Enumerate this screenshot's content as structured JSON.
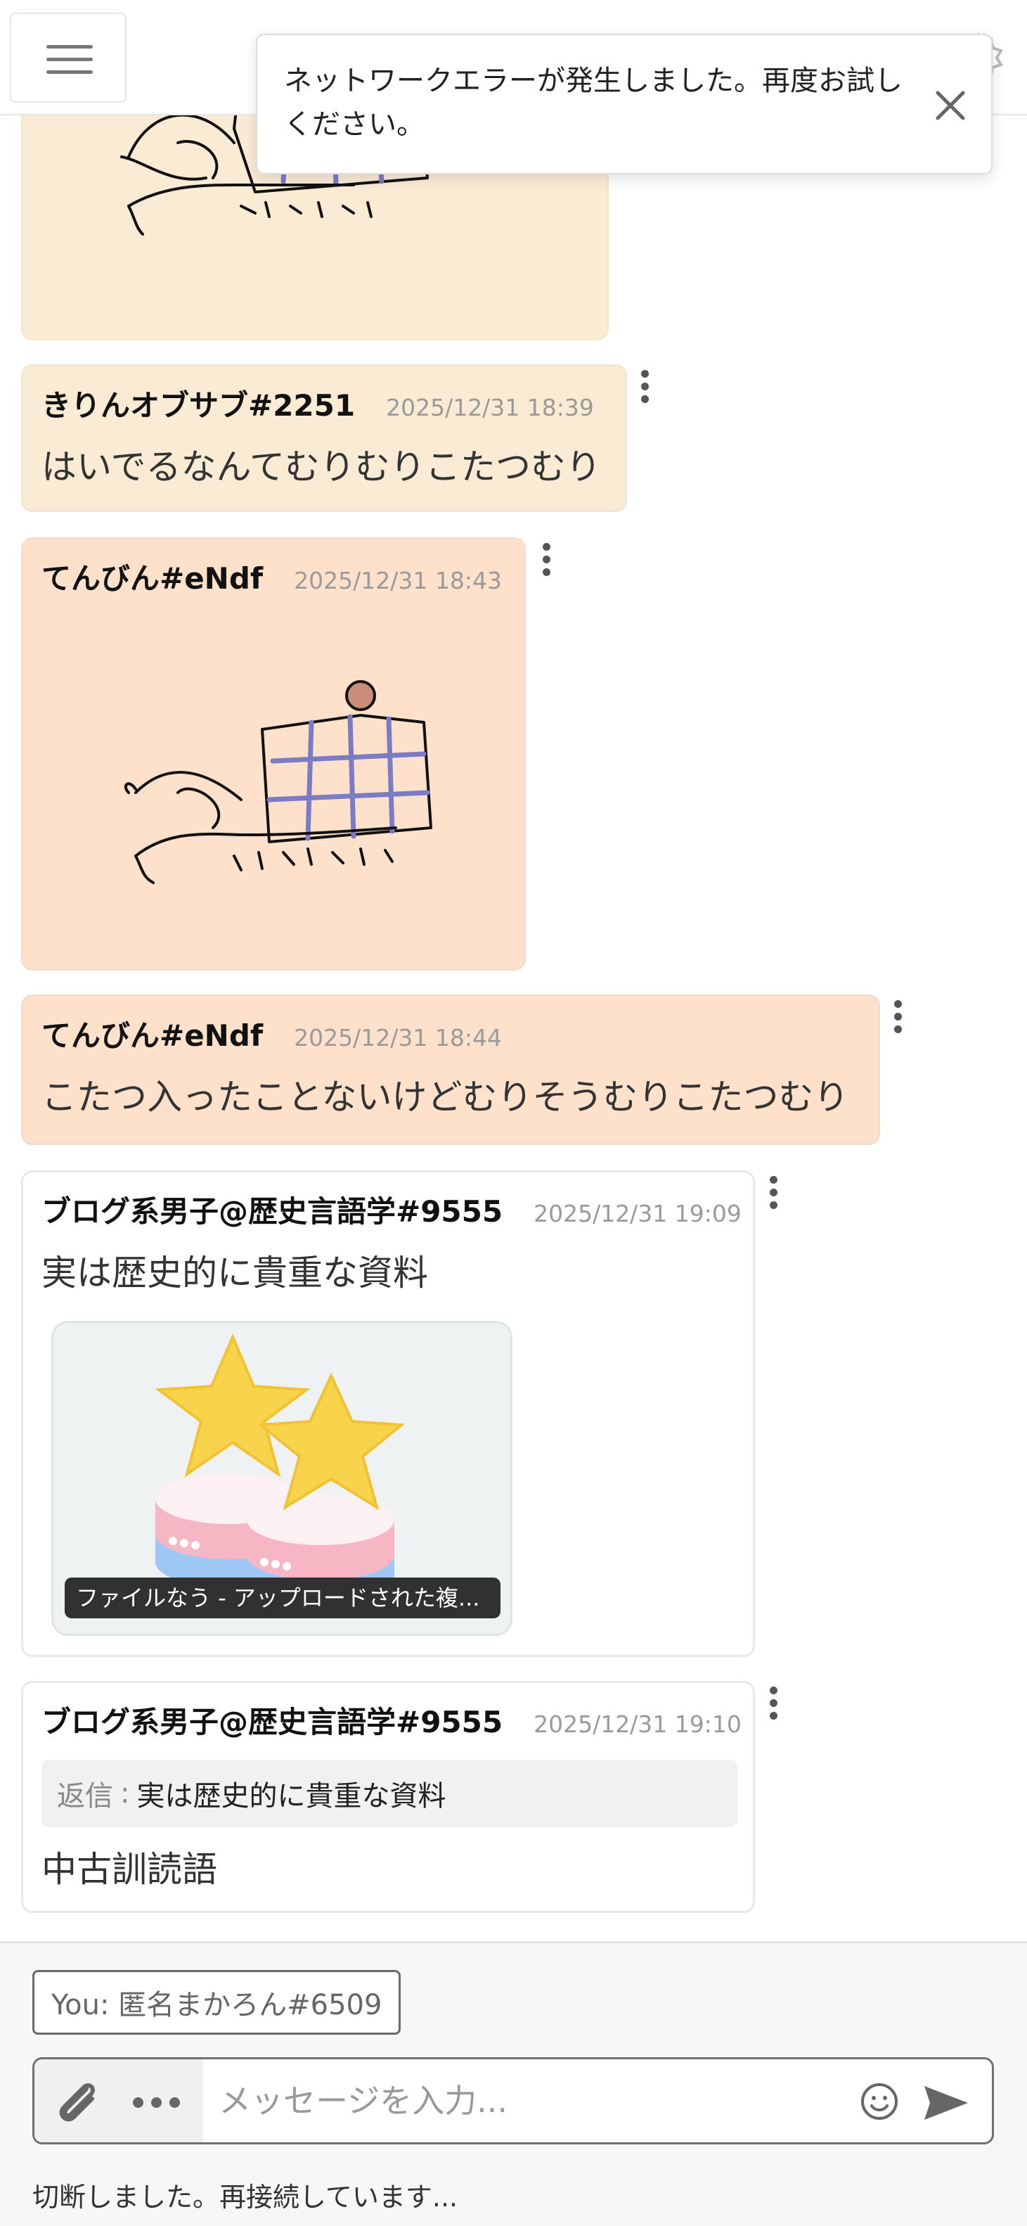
{
  "toast": {
    "message": "ネットワークエラーが発生しました。再度お試しください。"
  },
  "messages": [
    {
      "author": "きりんオブサブ#2251",
      "time": "2025/12/31 18:39",
      "text": "はいでるなんてむりむりこたつむり"
    },
    {
      "author": "てんびん#eNdf",
      "time": "2025/12/31 18:43"
    },
    {
      "author": "てんびん#eNdf",
      "time": "2025/12/31 18:44",
      "text": "こたつ入ったことないけどむりそうむりこたつむり"
    },
    {
      "author": "ブログ系男子@歴史言語学#9555",
      "time": "2025/12/31 19:09",
      "text": "実は歴史的に貴重な資料",
      "file_caption": "ファイルなう - アップロードされた複..."
    },
    {
      "author": "ブログ系男子@歴史言語学#9555",
      "time": "2025/12/31 19:10",
      "reply_label": "返信",
      "reply_text": "実は歴史的に貴重な資料",
      "text": "中古訓読語"
    }
  ],
  "footer": {
    "you_label": "You: 匿名まかろん#6509",
    "input_placeholder": "メッセージを入力...",
    "status": "切断しました。再接続しています..."
  },
  "icons": {
    "menu": "hamburger-menu-icon",
    "close": "close-icon",
    "more": "more-vertical-icon",
    "attach": "paperclip-icon",
    "more_horizontal": "more-horizontal-icon",
    "emoji": "smiley-icon",
    "send": "send-icon"
  },
  "colors": {
    "ochre_bubble": "#faebd5",
    "peach_bubble": "#fde1cb",
    "white_bubble": "#ffffff"
  }
}
